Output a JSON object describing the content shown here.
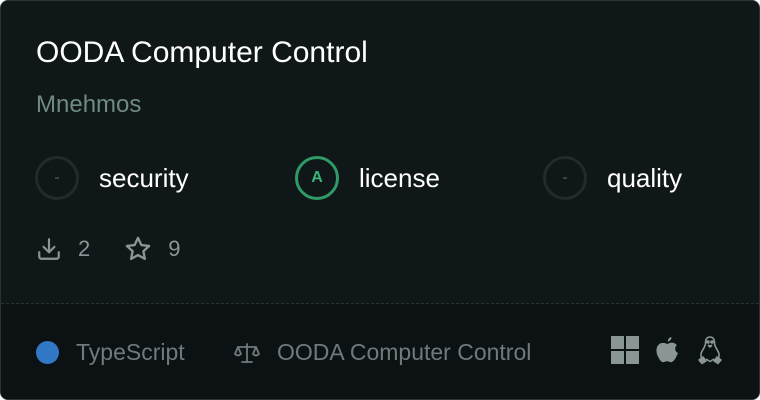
{
  "card": {
    "title": "OODA Computer Control",
    "author": "Mnehmos"
  },
  "scores": [
    {
      "grade": "-",
      "label": "security"
    },
    {
      "grade": "A",
      "label": "license",
      "color": "#2f9a66"
    },
    {
      "grade": "-",
      "label": "quality"
    }
  ],
  "stats": {
    "downloads": "2",
    "stars": "9"
  },
  "footer": {
    "language": "TypeScript",
    "language_color": "#3178c6",
    "license_name": "OODA Computer Control"
  },
  "platforms": [
    "windows-icon",
    "apple-icon",
    "linux-icon"
  ]
}
